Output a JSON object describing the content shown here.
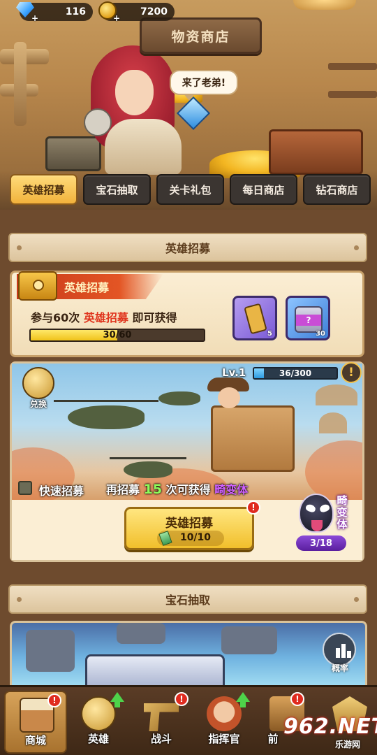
{
  "currency": {
    "gems": "116",
    "coins": "7200",
    "gem_icon": "diamond-icon",
    "coin_icon": "gold-coin-icon",
    "plus": "+"
  },
  "shop": {
    "sign": "物资商店",
    "speech": "来了老弟!"
  },
  "tabs": [
    {
      "label": "英雄招募",
      "active": true
    },
    {
      "label": "宝石抽取",
      "active": false
    },
    {
      "label": "关卡礼包",
      "active": false
    },
    {
      "label": "每日商店",
      "active": false
    },
    {
      "label": "钻石商店",
      "active": false
    }
  ],
  "hero_section": {
    "header": "英雄招募",
    "reward": {
      "title": "英雄招募",
      "desc_prefix": "参与60次",
      "desc_highlight": "英雄招募",
      "desc_suffix": "即可获得",
      "progress_text": "30/60",
      "progress_fraction": 0.5,
      "items": [
        {
          "icon": "walkie-talkie-icon",
          "count": "5"
        },
        {
          "icon": "mystery-can-icon",
          "count": "30",
          "label": "?"
        }
      ]
    },
    "recruit": {
      "exchange_label": "兑换",
      "level_label": "Lv.1",
      "level_progress_text": "36/300",
      "level_fraction": 0.12,
      "info_badge": "!",
      "quick_label": "快速招募",
      "msg_prefix": "再招募",
      "msg_number": "15",
      "msg_mid": "次可获得",
      "msg_target": "畸变体",
      "button_label": "英雄招募",
      "button_count": "10/10",
      "button_badge": "!",
      "venom_label": "畸变体",
      "venom_count": "3/18"
    }
  },
  "gem_section": {
    "header": "宝石抽取",
    "rate_label": "概率"
  },
  "nav": [
    {
      "label": "商城",
      "icon": "shop-stall-icon",
      "badge": "!",
      "active": true
    },
    {
      "label": "英雄",
      "icon": "hero-emblem-icon",
      "badge": "up",
      "active": false
    },
    {
      "label": "战斗",
      "icon": "pistol-icon",
      "badge": "!",
      "active": false
    },
    {
      "label": "指挥官",
      "icon": "commander-icon",
      "badge": "up",
      "active": false
    },
    {
      "label": "前",
      "icon": "frontline-icon",
      "badge": "!",
      "active": false
    },
    {
      "label": "",
      "icon": "rank-emblem-icon",
      "badge": "",
      "active": false
    }
  ],
  "watermark": {
    "brand": "962.NET",
    "sub": "乐游网"
  },
  "colors": {
    "tab_active": "#f1b23c",
    "highlight_red": "#e0351e",
    "highlight_purple": "#d061ff",
    "highlight_green": "#8dfa5a",
    "badge_red": "#e02b1f"
  }
}
